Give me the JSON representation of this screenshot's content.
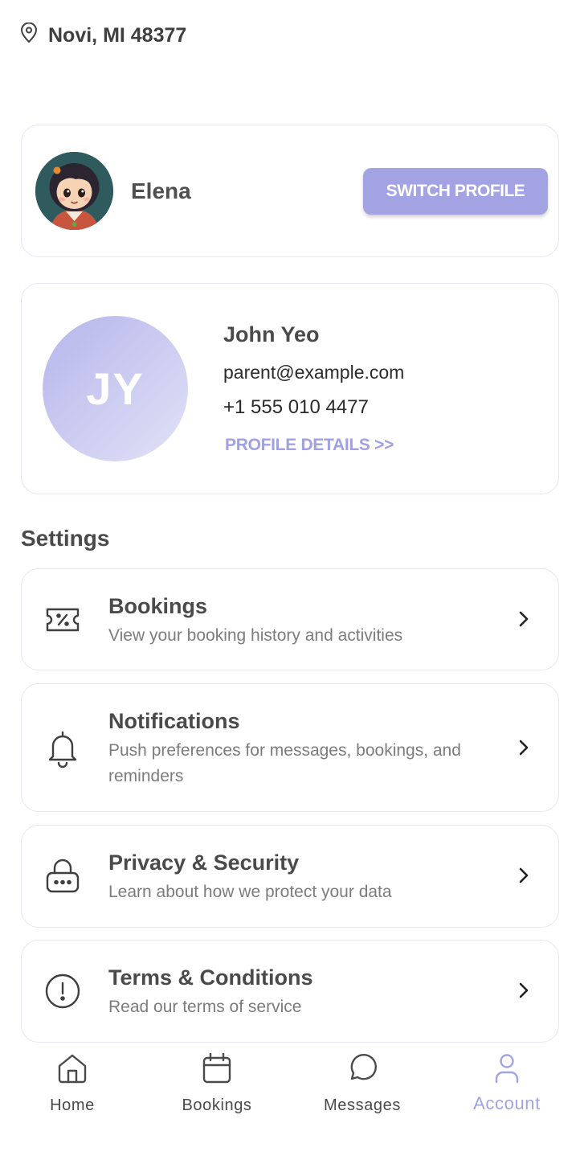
{
  "location": {
    "icon": "map-pin-icon",
    "text": "Novi, MI 48377"
  },
  "child_profile": {
    "name": "Elena",
    "avatar": "child-avatar-illustration",
    "switch_label": "SWITCH PROFILE"
  },
  "parent_profile": {
    "initials": "JY",
    "name": "John Yeo",
    "email": "parent@example.com",
    "phone": "+1 555 010 4477",
    "details_link": "PROFILE DETAILS >>"
  },
  "settings": {
    "title": "Settings",
    "items": [
      {
        "icon": "ticket-discount-icon",
        "title": "Bookings",
        "description": "View your booking history and activities"
      },
      {
        "icon": "bell-icon",
        "title": "Notifications",
        "description": "Push preferences for messages, bookings, and reminders"
      },
      {
        "icon": "lock-icon",
        "title": "Privacy & Security",
        "description": "Learn about how we protect your data"
      },
      {
        "icon": "info-circle-icon",
        "title": "Terms & Conditions",
        "description": "Read our terms of service"
      }
    ]
  },
  "bottom_nav": {
    "items": [
      {
        "icon": "home-icon",
        "label": "Home",
        "active": false
      },
      {
        "icon": "calendar-icon",
        "label": "Bookings",
        "active": false
      },
      {
        "icon": "chat-bubble-icon",
        "label": "Messages",
        "active": false
      },
      {
        "icon": "user-icon",
        "label": "Account",
        "active": true
      }
    ]
  },
  "colors": {
    "accent": "#a3a3e4",
    "card_border": "#e6e6f4",
    "text_primary": "#4a4a4a",
    "text_secondary": "#7c7c7c"
  }
}
